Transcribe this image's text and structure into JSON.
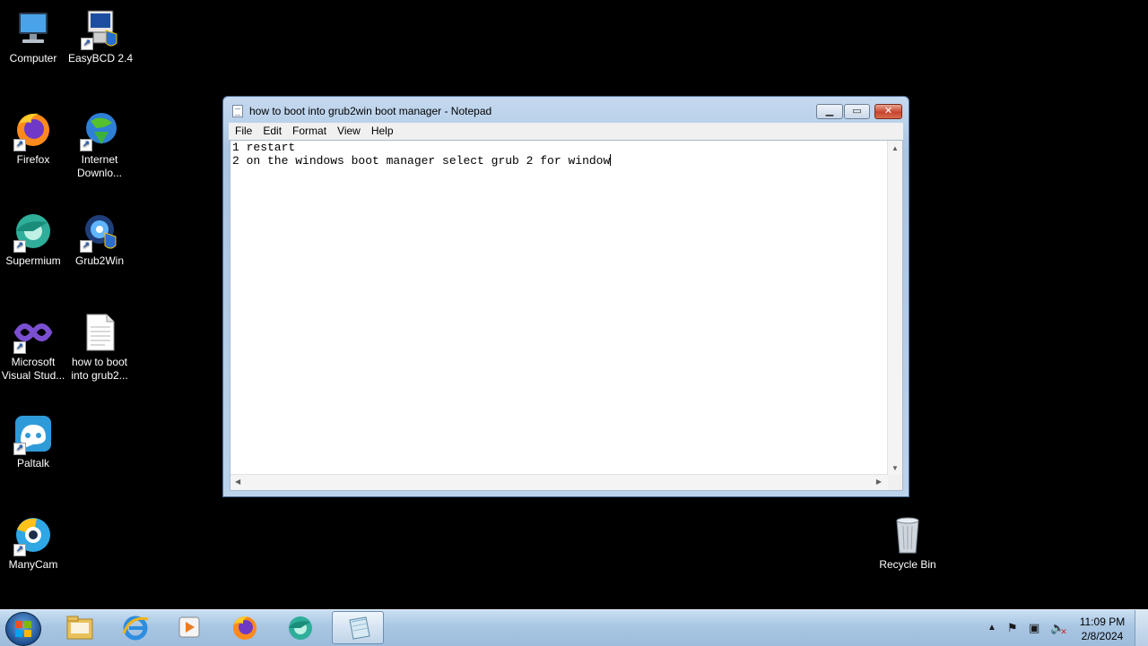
{
  "desktop": {
    "icons": [
      {
        "label": "Computer",
        "icon": "computer-icon"
      },
      {
        "label": "EasyBCD 2.4",
        "icon": "easybcd-icon"
      },
      {
        "label": "Firefox",
        "icon": "firefox-icon"
      },
      {
        "label": "Internet Downlo...",
        "icon": "internet-download-manager-icon"
      },
      {
        "label": "Supermium",
        "icon": "supermium-icon"
      },
      {
        "label": "Grub2Win",
        "icon": "grub2win-icon"
      },
      {
        "label": "Microsoft Visual Stud...",
        "icon": "visual-studio-icon"
      },
      {
        "label": "how to boot into grub2...",
        "icon": "text-file-icon"
      },
      {
        "label": "Paltalk",
        "icon": "paltalk-icon"
      },
      {
        "label": "ManyCam",
        "icon": "manycam-icon"
      },
      {
        "label": "Recycle Bin",
        "icon": "recycle-bin-icon"
      }
    ]
  },
  "notepad": {
    "title": "how to boot into grub2win boot manager - Notepad",
    "menu": [
      "File",
      "Edit",
      "Format",
      "View",
      "Help"
    ],
    "lines": [
      "1 restart",
      "2 on the windows boot manager select grub 2 for window"
    ]
  },
  "taskbar": {
    "pinned": [
      {
        "icon": "windows-explorer-icon"
      },
      {
        "icon": "internet-explorer-icon"
      },
      {
        "icon": "media-player-icon"
      },
      {
        "icon": "firefox-icon"
      },
      {
        "icon": "supermium-icon"
      },
      {
        "icon": "notepad-icon",
        "active": true
      }
    ],
    "clock": {
      "time": "11:09 PM",
      "date": "2/8/2024"
    }
  }
}
